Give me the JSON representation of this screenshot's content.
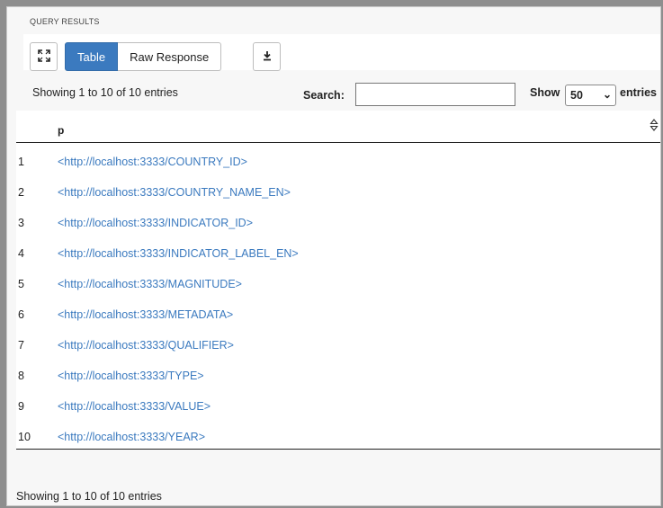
{
  "panel": {
    "title": "QUERY RESULTS"
  },
  "toolbar": {
    "expand_icon": "expand-icon",
    "tabs": [
      {
        "label": "Table",
        "active": true
      },
      {
        "label": "Raw Response",
        "active": false
      }
    ],
    "download_icon": "download-icon"
  },
  "controls": {
    "info_top": "Showing 1 to 10 of 10 entries",
    "search_label": "Search:",
    "search_value": "",
    "show_label": "Show",
    "show_value": "50",
    "entries_label": "entries"
  },
  "table": {
    "column_header": "p",
    "sort_icon": "sort-icon",
    "rows": [
      {
        "index": "1",
        "value": "<http://localhost:3333/COUNTRY_ID>"
      },
      {
        "index": "2",
        "value": "<http://localhost:3333/COUNTRY_NAME_EN>"
      },
      {
        "index": "3",
        "value": "<http://localhost:3333/INDICATOR_ID>"
      },
      {
        "index": "4",
        "value": "<http://localhost:3333/INDICATOR_LABEL_EN>"
      },
      {
        "index": "5",
        "value": "<http://localhost:3333/MAGNITUDE>"
      },
      {
        "index": "6",
        "value": "<http://localhost:3333/METADATA>"
      },
      {
        "index": "7",
        "value": "<http://localhost:3333/QUALIFIER>"
      },
      {
        "index": "8",
        "value": "<http://localhost:3333/TYPE>"
      },
      {
        "index": "9",
        "value": "<http://localhost:3333/VALUE>"
      },
      {
        "index": "10",
        "value": "<http://localhost:3333/YEAR>"
      }
    ]
  },
  "footer": {
    "info_bottom": "Showing 1 to 10 of 10 entries"
  },
  "colors": {
    "accent": "#3b7abf",
    "link": "#3b7abf"
  }
}
